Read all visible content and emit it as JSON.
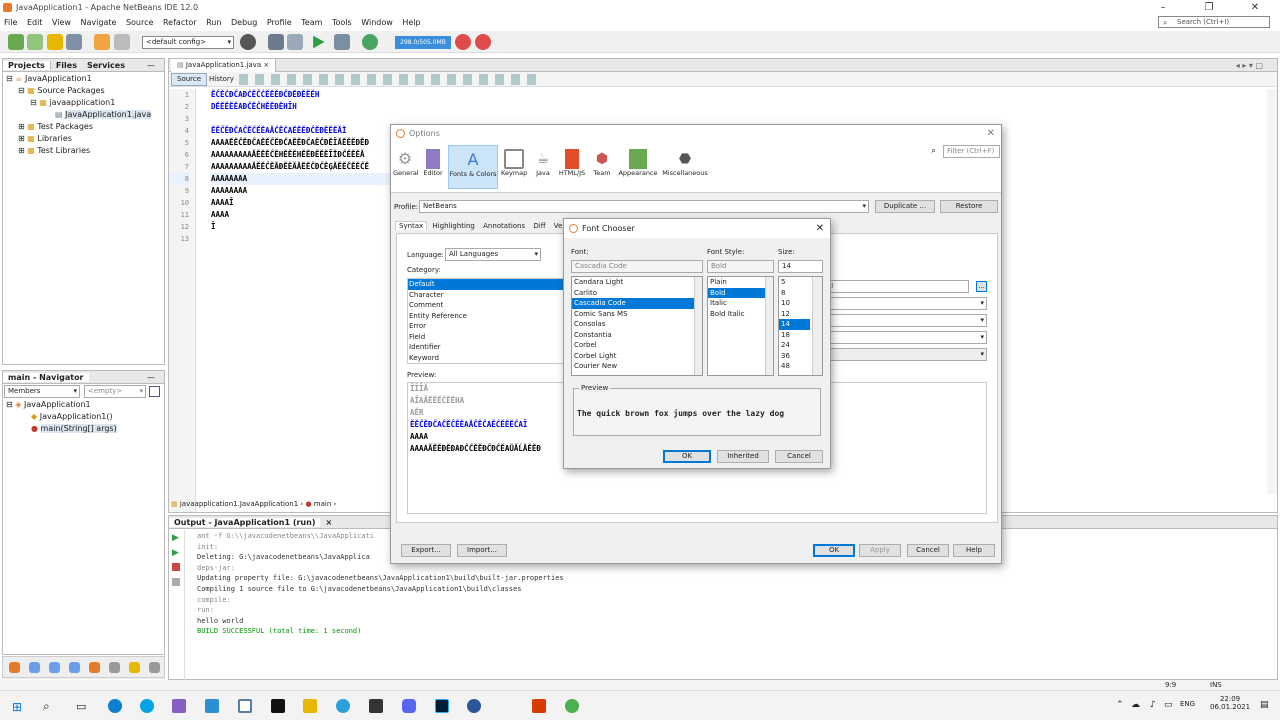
{
  "window": {
    "title": "JavaApplication1 - Apache NetBeans IDE 12.0"
  },
  "menu": [
    "File",
    "Edit",
    "View",
    "Navigate",
    "Source",
    "Refactor",
    "Run",
    "Debug",
    "Profile",
    "Team",
    "Tools",
    "Window",
    "Help"
  ],
  "search": {
    "placeholder": "Search (Ctrl+I)"
  },
  "toolbar": {
    "config": "<default config>",
    "memory": "298.0/505.0MB"
  },
  "projects": {
    "tabs": [
      "Projects",
      "Files",
      "Services"
    ],
    "tree": [
      "JavaApplication1",
      "Source Packages",
      "javaapplication1",
      "JavaApplication1.java",
      "Test Packages",
      "Libraries",
      "Test Libraries"
    ]
  },
  "navigator": {
    "title": "main - Navigator",
    "members": "Members",
    "empty": "<empty>",
    "tree": [
      "JavaApplication1",
      "JavaApplication1()",
      "main(String[] args)"
    ]
  },
  "editor": {
    "tab": "JavaApplication1.java",
    "source_tab": "Source",
    "history_tab": "History",
    "line_numbers": [
      "1",
      "2",
      "3",
      "4",
      "5",
      "6",
      "7",
      "8",
      "9",
      "10",
      "11",
      "12",
      "13"
    ],
    "lines": [
      "ĔĈĔĊĐĈAĐĊĔĈĊĔĔĔĐĈĐĔĐĔĔĔH",
      "DĔĔĔĔĔAĐĈĔĈHĔĔĐĔHĪH",
      "",
      "ĔĔĈĔĐĈAĈĔĈĔĔAĂĈĔĊAĔĔĔĐĈĔĐĔĔĔĂĬ",
      "AAAAĔĔĈĔĐĈAĔĔĈĔĐĈAĔĔĐĈAĔĈĐĔĪĂĔĔĔĐĔĐ",
      "AAAAAAAAAĂĔĔĔĈĔHĔĔĔHĔĔĐĔĔĔĪĬĐĈĔĔĔĂ",
      "AAAAAAAAAĂĔĔĈĔĂĐĔĔĂĂĔĔĈĐĈĔĢĂĔĔĈĔĔĈĔ",
      "AAAAAAAA",
      "AAAAAAAA",
      "AAAAĪ",
      "AAAA",
      "Ī",
      ""
    ],
    "breadcrumb": [
      "javaapplication1.JavaApplication1",
      "main"
    ]
  },
  "output": {
    "title": "Output - JavaApplication1 (run)",
    "lines": [
      "ant -f G:\\\\javacodenetbeans\\\\JavaApplicati",
      "init:",
      "Deleting: G:\\javacodenetbeans\\JavaApplica",
      "deps-jar:",
      "Updating property file: G:\\javacodenetbeans\\JavaApplication1\\build\\built-jar.properties",
      "Compiling 1 source file to G:\\javacodenetbeans\\JavaApplication1\\build\\classes",
      "compile:",
      "run:",
      "hello world",
      "BUILD SUCCESSFUL (total time: 1 second)"
    ]
  },
  "options": {
    "title": "Options",
    "filter_placeholder": "Filter (Ctrl+F)",
    "categories": [
      "General",
      "Editor",
      "Fonts & Colors",
      "Keymap",
      "Java",
      "HTML/JS",
      "Team",
      "Appearance",
      "Miscellaneous"
    ],
    "profile_label": "Profile:",
    "profile": "NetBeans",
    "duplicate": "Duplicate ...",
    "restore": "Restore",
    "subtabs": [
      "Syntax",
      "Highlighting",
      "Annotations",
      "Diff",
      "Versioning"
    ],
    "language_label": "Language:",
    "language": "All Languages",
    "category_label": "Category:",
    "category_items": [
      "Default",
      "Character",
      "Comment",
      "Entity Reference",
      "Error",
      "Field",
      "Identifier",
      "Keyword"
    ],
    "preview_label": "Preview:",
    "preview_lines": [
      "ĪĪĪĂ",
      "AĪAĂĔĔĔĈĔĔHA",
      "AĔR",
      "ĔĔĈĔĐĈAĈĔĈĔĔAĂĈĔĈAĔĈĔĔĔĈAĪ",
      "AAAA",
      "AAAAĂĔĔĐĔĐAĐĈĈĔĔĐĈĐĈĔAŬĂĹĂĔĔĐ"
    ],
    "export": "Export...",
    "import": "Import...",
    "ok": "OK",
    "apply": "Apply",
    "cancel": "Cancel",
    "help": "Help"
  },
  "font_chooser": {
    "title": "Font Chooser",
    "font_label": "Font:",
    "style_label": "Font Style:",
    "size_label": "Size:",
    "font_value": "Cascadia Code",
    "style_value": "Bold",
    "size_value": "14",
    "fonts": [
      "Candara Light",
      "Carlito",
      "Cascadia Code",
      "Comic Sans MS",
      "Consolas",
      "Constantia",
      "Corbel",
      "Corbel Light",
      "Courier New"
    ],
    "styles": [
      "Plain",
      "Bold",
      "Italic",
      "Bold Italic"
    ],
    "sizes": [
      "5",
      "8",
      "10",
      "12",
      "14",
      "18",
      "24",
      "36",
      "48"
    ],
    "preview_label": "Preview",
    "preview_text": "The quick brown fox jumps over the lazy dog",
    "ok": "OK",
    "inherited": "Inherited",
    "cancel": "Cancel"
  },
  "status": {
    "position": "9:9",
    "mode": "INS"
  },
  "tray": {
    "lang": "ENG",
    "time": "22:09",
    "date": "06.01.2021"
  },
  "colors": {
    "accent": "#0078d7",
    "keyword_blue": "#0000e6",
    "green": "#009900",
    "orange": "#ce7b00"
  }
}
